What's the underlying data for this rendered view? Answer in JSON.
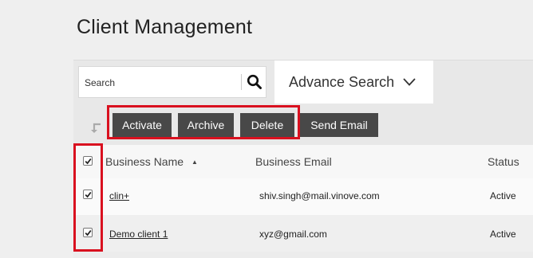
{
  "page_title": "Client Management",
  "search": {
    "placeholder": "Search"
  },
  "advance_search": {
    "label": "Advance Search"
  },
  "actions": {
    "activate": "Activate",
    "archive": "Archive",
    "delete": "Delete",
    "send_email": "Send Email"
  },
  "table": {
    "headers": {
      "name": "Business Name",
      "email": "Business Email",
      "status": "Status"
    },
    "sort_indicator": "▲",
    "rows": [
      {
        "name": "clin+",
        "email": "shiv.singh@mail.vinove.com",
        "status": "Active"
      },
      {
        "name": "Demo client 1",
        "email": "xyz@gmail.com",
        "status": "Active"
      }
    ]
  },
  "colors": {
    "highlight": "#d9101f",
    "button_bg": "#484848"
  }
}
